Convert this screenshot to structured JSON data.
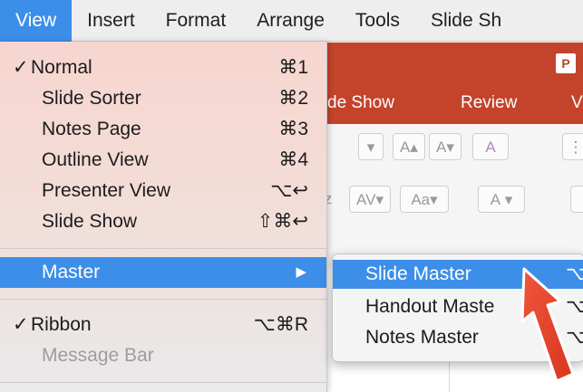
{
  "menubar": {
    "items": [
      "View",
      "Insert",
      "Format",
      "Arrange",
      "Tools",
      "Slide Sh"
    ]
  },
  "app": {
    "tabs": [
      "de Show",
      "Review",
      "V"
    ],
    "icon_letter": "P",
    "ribbon_glyphs": [
      "A",
      "A",
      "A",
      "AV",
      "Aa",
      "A",
      "z"
    ]
  },
  "view_menu": {
    "groups": [
      [
        {
          "check": "✓",
          "label": "Normal",
          "shortcut": "⌘1"
        },
        {
          "check": "",
          "label": "Slide Sorter",
          "shortcut": "⌘2"
        },
        {
          "check": "",
          "label": "Notes Page",
          "shortcut": "⌘3"
        },
        {
          "check": "",
          "label": "Outline View",
          "shortcut": "⌘4"
        },
        {
          "check": "",
          "label": "Presenter View",
          "shortcut": "⌥↩"
        },
        {
          "check": "",
          "label": "Slide Show",
          "shortcut": "⇧⌘↩"
        }
      ],
      [
        {
          "check": "",
          "label": "Master",
          "shortcut": "▶",
          "highlighted": true
        }
      ],
      [
        {
          "check": "✓",
          "label": "Ribbon",
          "shortcut": "⌥⌘R"
        },
        {
          "check": "",
          "label": "Message Bar",
          "shortcut": "",
          "disabled": true
        }
      ]
    ]
  },
  "master_submenu": {
    "items": [
      {
        "label": "Slide Master",
        "shortcut": "⌥",
        "highlighted": true
      },
      {
        "label": "Handout Maste",
        "shortcut": "⌥"
      },
      {
        "label": "Notes Master",
        "shortcut": "⌥"
      }
    ]
  },
  "colors": {
    "accent": "#3d8ee9",
    "powerpoint_red": "#c4432b",
    "annotation_arrow": "#e8412c"
  }
}
